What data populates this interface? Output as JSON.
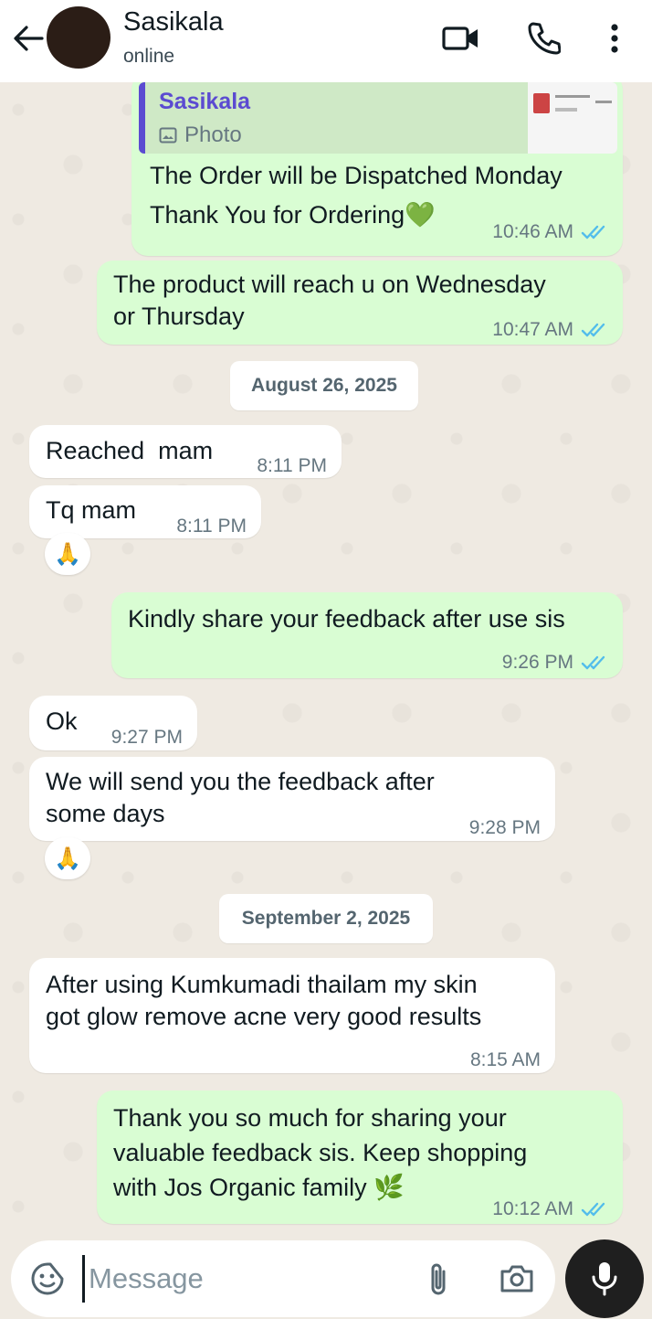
{
  "header": {
    "contact_name": "Sasikala",
    "status": "online",
    "icons": [
      "back-arrow-icon",
      "video-call-icon",
      "voice-call-icon",
      "more-vertical-icon"
    ]
  },
  "colors": {
    "outgoing_bubble": "#d9fdd3",
    "incoming_bubble": "#ffffff",
    "read_ticks": "#53bdeb",
    "quote_accent": "#5b4bd1"
  },
  "messages": [
    {
      "direction": "out",
      "quoted": {
        "name": "Sasikala",
        "type": "Photo"
      },
      "text": "The Order will be Dispatched Monday\nThank You for Ordering💚",
      "time": "10:46 AM",
      "status": "read"
    },
    {
      "direction": "out",
      "text": "The product will reach u on Wednesday\nor Thursday",
      "time": "10:47 AM",
      "status": "read"
    },
    {
      "date_chip": "August 26, 2025"
    },
    {
      "direction": "in",
      "text": "Reached  mam",
      "time": "8:11 PM"
    },
    {
      "direction": "in",
      "text": "Tq mam",
      "time": "8:11 PM",
      "reaction": "🙏"
    },
    {
      "direction": "out",
      "text": "Kindly share your feedback after use sis",
      "time": "9:26 PM",
      "status": "read"
    },
    {
      "direction": "in",
      "text": "Ok",
      "time": "9:27 PM"
    },
    {
      "direction": "in",
      "text": "We will send you the feedback after\nsome days",
      "time": "9:28 PM",
      "reaction": "🙏"
    },
    {
      "date_chip": "September 2, 2025"
    },
    {
      "direction": "in",
      "text": "After using Kumkumadi thailam my skin\ngot glow remove acne very good results",
      "time": "8:15 AM"
    },
    {
      "direction": "out",
      "text": "Thank you so much for sharing your\nvaluable feedback sis. Keep shopping\nwith Jos Organic family 🌿",
      "time": "10:12 AM",
      "status": "read"
    }
  ],
  "composer": {
    "placeholder": "Message",
    "icons": [
      "sticker-emoji-icon",
      "attach-paperclip-icon",
      "camera-icon",
      "microphone-icon"
    ]
  }
}
